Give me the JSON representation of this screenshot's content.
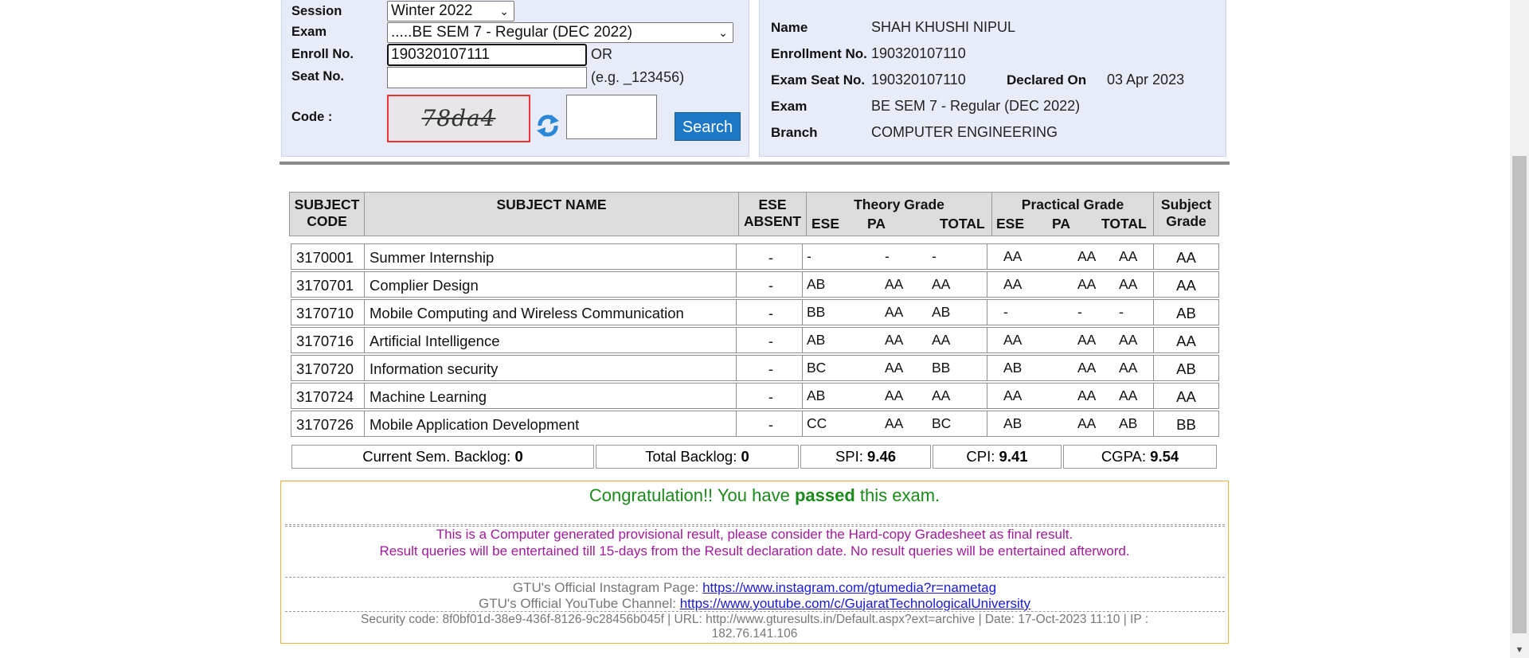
{
  "search_form": {
    "session_label": "Session",
    "session_value": "Winter 2022",
    "exam_label": "Exam",
    "exam_value": ".....BE SEM 7 - Regular (DEC 2022)",
    "enroll_label": "Enroll No.",
    "enroll_value": "190320107111",
    "or_text": "OR",
    "seat_label": "Seat No.",
    "seat_value": "",
    "seat_hint": "(e.g. _123456)",
    "code_label": "Code :",
    "captcha_text": "78da4",
    "code_value": "",
    "search_label": "Search"
  },
  "student": {
    "name_label": "Name",
    "name": "SHAH KHUSHI NIPUL",
    "enrollment_label": "Enrollment No.",
    "enrollment": "190320107110",
    "seat_label": "Exam Seat No.",
    "seat": "190320107110",
    "declared_label": "Declared On",
    "declared": "03 Apr 2023",
    "exam_label": "Exam",
    "exam": "BE SEM 7 - Regular (DEC 2022)",
    "branch_label": "Branch",
    "branch": "COMPUTER ENGINEERING"
  },
  "table_headers": {
    "code": [
      "SUBJECT",
      "CODE"
    ],
    "name": "SUBJECT NAME",
    "ese_absent": [
      "ESE",
      "ABSENT"
    ],
    "theory": "Theory Grade",
    "practical": "Practical Grade",
    "subject_grade": [
      "Subject",
      "Grade"
    ],
    "ese": "ESE",
    "pa": "PA",
    "total": "TOTAL"
  },
  "subjects": [
    {
      "code": "3170001",
      "name": "Summer Internship",
      "absent": "-",
      "t_ese": "-",
      "t_pa": "-",
      "t_total": "-",
      "p_ese": "AA",
      "p_pa": "AA",
      "p_total": "AA",
      "grade": "AA"
    },
    {
      "code": "3170701",
      "name": "Complier Design",
      "absent": "-",
      "t_ese": "AB",
      "t_pa": "AA",
      "t_total": "AA",
      "p_ese": "AA",
      "p_pa": "AA",
      "p_total": "AA",
      "grade": "AA"
    },
    {
      "code": "3170710",
      "name": "Mobile Computing and Wireless Communication",
      "absent": "-",
      "t_ese": "BB",
      "t_pa": "AA",
      "t_total": "AB",
      "p_ese": "-",
      "p_pa": "-",
      "p_total": "-",
      "grade": "AB"
    },
    {
      "code": "3170716",
      "name": "Artificial Intelligence",
      "absent": "-",
      "t_ese": "AB",
      "t_pa": "AA",
      "t_total": "AA",
      "p_ese": "AA",
      "p_pa": "AA",
      "p_total": "AA",
      "grade": "AA"
    },
    {
      "code": "3170720",
      "name": "Information security",
      "absent": "-",
      "t_ese": "BC",
      "t_pa": "AA",
      "t_total": "BB",
      "p_ese": "AB",
      "p_pa": "AA",
      "p_total": "AA",
      "grade": "AB"
    },
    {
      "code": "3170724",
      "name": "Machine Learning",
      "absent": "-",
      "t_ese": "AB",
      "t_pa": "AA",
      "t_total": "AA",
      "p_ese": "AA",
      "p_pa": "AA",
      "p_total": "AA",
      "grade": "AA"
    },
    {
      "code": "3170726",
      "name": "Mobile Application Development",
      "absent": "-",
      "t_ese": "CC",
      "t_pa": "AA",
      "t_total": "BC",
      "p_ese": "AB",
      "p_pa": "AA",
      "p_total": "AB",
      "grade": "BB"
    }
  ],
  "summary": {
    "cur_backlog_label": "Current Sem. Backlog:",
    "cur_backlog": "0",
    "total_backlog_label": "Total Backlog:",
    "total_backlog": "0",
    "spi_label": "SPI:",
    "spi": "9.46",
    "cpi_label": "CPI:",
    "cpi": "9.41",
    "cgpa_label": "CGPA:",
    "cgpa": "9.54"
  },
  "result": {
    "congrats_prefix": "Congratulation!! You have ",
    "congrats_bold": "passed",
    "congrats_suffix": " this exam.",
    "note1": "This is a Computer generated provisional result, please consider the Hard-copy Gradesheet as final result.",
    "note2": "Result queries will be entertained till 15-days from the Result declaration date. No result queries will be entertained afterword.",
    "insta_label": "GTU's Official Instagram Page: ",
    "insta_link": "https://www.instagram.com/gtumedia?r=nametag",
    "yt_label": "GTU's Official YouTube Channel: ",
    "yt_link": "https://www.youtube.com/c/GujaratTechnologicalUniversity",
    "security_line1": "Security code: 8f0bf01d-38e9-436f-8126-9c28456b045f | URL: http://www.gturesults.in/Default.aspx?ext=archive | Date: 17-Oct-2023 11:10 | IP :",
    "security_line2": "182.76.141.106"
  },
  "colors": {
    "panel_bg": "#e7ecf8",
    "search_button": "#1e78c8",
    "congrats_green": "#1a8a1a",
    "notice_purple": "#a01a9a",
    "result_border": "#f0b13a",
    "captcha_border": "#e33333"
  }
}
